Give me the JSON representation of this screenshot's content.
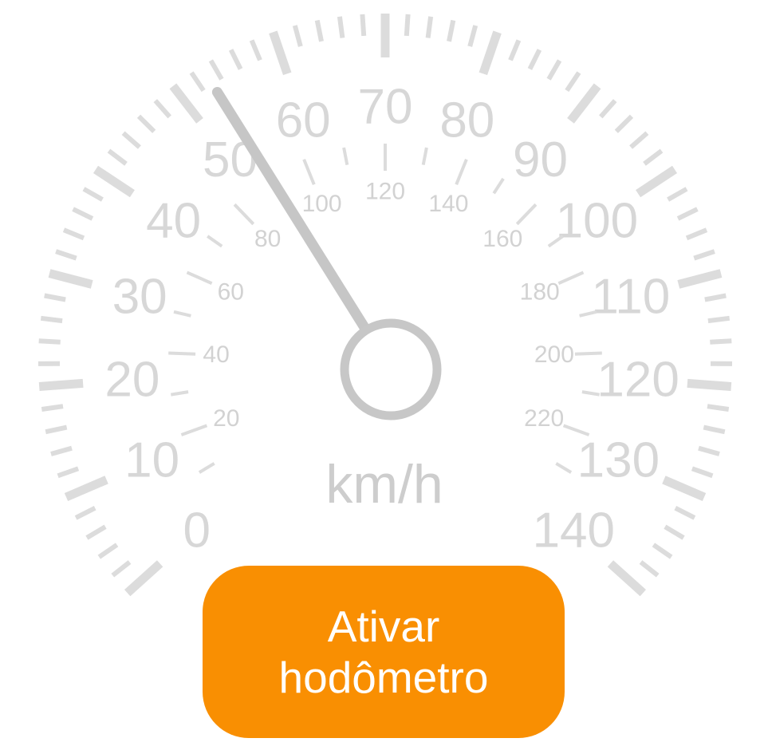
{
  "gauge": {
    "unit": "km/h",
    "outer_scale": {
      "labels": [
        "0",
        "10",
        "20",
        "30",
        "40",
        "50",
        "60",
        "70",
        "80",
        "90",
        "100",
        "110",
        "120",
        "130",
        "140"
      ],
      "min": 0,
      "max": 140,
      "major_step": 10
    },
    "inner_scale": {
      "labels": [
        "20",
        "40",
        "60",
        "80",
        "100",
        "120",
        "140",
        "160",
        "180",
        "200",
        "220"
      ],
      "min": 0,
      "max": 240,
      "major_step": 20
    },
    "needle_value_kmh": 53,
    "colors": {
      "ticks": "#dcdcdc",
      "needle": "#c6c6c6",
      "hub_ring": "#c7c7c7",
      "button": "#f98f02",
      "button_text": "#ffffff"
    }
  },
  "button": {
    "label": "Ativar\nhodômetro"
  }
}
